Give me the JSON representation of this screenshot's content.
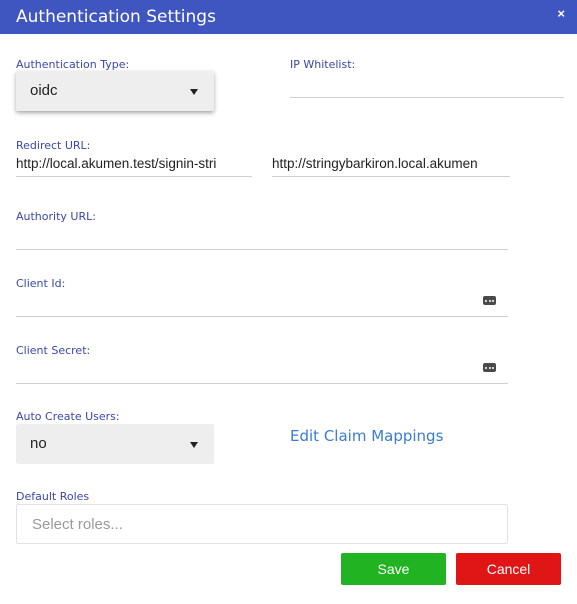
{
  "dialog": {
    "title": "Authentication Settings",
    "close_label": "×"
  },
  "auth_type": {
    "label": "Authentication Type:",
    "value": "oidc"
  },
  "ip_whitelist": {
    "label": "IP Whitelist:",
    "value": ""
  },
  "redirect_url": {
    "label": "Redirect URL:",
    "value": "http://local.akumen.test/signin-stri",
    "value_2": "http://stringybarkiron.local.akumen"
  },
  "authority_url": {
    "label": "Authority URL:",
    "value": ""
  },
  "client_id": {
    "label": "Client Id:",
    "value": "",
    "icon": "password-dots-icon"
  },
  "client_secret": {
    "label": "Client Secret:",
    "value": "",
    "icon": "password-dots-icon"
  },
  "auto_create": {
    "label": "Auto Create Users:",
    "value": "no"
  },
  "claim_mappings": {
    "link_label": "Edit Claim Mappings"
  },
  "default_roles": {
    "label": "Default Roles",
    "placeholder": "Select roles..."
  },
  "buttons": {
    "save_label": "Save",
    "cancel_label": "Cancel"
  },
  "colors": {
    "titlebar": "#3f55c0",
    "label": "#3a46a8",
    "link": "#3a7bd5",
    "save": "#22b322",
    "cancel": "#e01616"
  }
}
